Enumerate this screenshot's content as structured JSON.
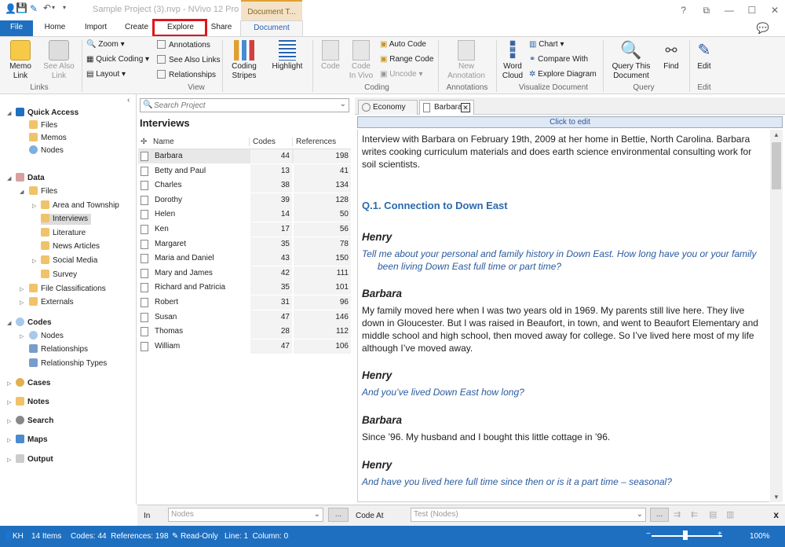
{
  "window": {
    "title": "Sample Project (3).nvp - NVivo 12 Pro",
    "context_tab": "Document T...",
    "help": "?",
    "restore": "⧉",
    "minimize": "—",
    "maximize": "☐",
    "close": "✕"
  },
  "tabs": [
    "File",
    "Home",
    "Import",
    "Create",
    "Explore",
    "Share",
    "Document"
  ],
  "ribbon": {
    "memo_link": "Memo\nLink",
    "see_also_link": "See Also\nLink",
    "links_group": "Links",
    "zoom": "Zoom",
    "quick_coding": "Quick Coding",
    "layout": "Layout",
    "annotations": "Annotations",
    "see_also_links": "See Also Links",
    "relationships": "Relationships",
    "view_group": "View",
    "coding_stripes": "Coding\nStripes",
    "highlight": "Highlight",
    "code": "Code",
    "code_in_vivo": "Code\nIn Vivo",
    "auto_code": "Auto Code",
    "range_code": "Range Code",
    "uncode": "Uncode",
    "coding_group": "Coding",
    "new_annotation": "New\nAnnotation",
    "annotations_group": "Annotations",
    "word_cloud": "Word\nCloud",
    "chart": "Chart",
    "compare_with": "Compare With",
    "explore_diagram": "Explore Diagram",
    "visualize_group": "Visualize Document",
    "query_this_document": "Query This\nDocument",
    "find": "Find",
    "query_group": "Query",
    "edit": "Edit",
    "edit_group": "Edit"
  },
  "nav": {
    "quick_access": "Quick Access",
    "files": "Files",
    "memos": "Memos",
    "nodes": "Nodes",
    "data": "Data",
    "data_files": "Files",
    "area_township": "Area and Township",
    "interviews": "Interviews",
    "literature": "Literature",
    "news_articles": "News Articles",
    "social_media": "Social Media",
    "survey": "Survey",
    "file_classifications": "File Classifications",
    "externals": "Externals",
    "codes": "Codes",
    "codes_nodes": "Nodes",
    "relationships": "Relationships",
    "relationship_types": "Relationship Types",
    "cases": "Cases",
    "notes": "Notes",
    "search": "Search",
    "maps": "Maps",
    "output": "Output"
  },
  "list": {
    "search_placeholder": "Search Project",
    "folder_title": "Interviews",
    "col_name": "Name",
    "col_codes": "Codes",
    "col_refs": "References",
    "rows": [
      {
        "name": "Barbara",
        "codes": "44",
        "refs": "198"
      },
      {
        "name": "Betty and Paul",
        "codes": "13",
        "refs": "41"
      },
      {
        "name": "Charles",
        "codes": "38",
        "refs": "134"
      },
      {
        "name": "Dorothy",
        "codes": "39",
        "refs": "128"
      },
      {
        "name": "Helen",
        "codes": "14",
        "refs": "50"
      },
      {
        "name": "Ken",
        "codes": "17",
        "refs": "56"
      },
      {
        "name": "Margaret",
        "codes": "35",
        "refs": "78"
      },
      {
        "name": "Maria and Daniel",
        "codes": "43",
        "refs": "150"
      },
      {
        "name": "Mary and James",
        "codes": "42",
        "refs": "111"
      },
      {
        "name": "Richard and Patricia",
        "codes": "35",
        "refs": "101"
      },
      {
        "name": "Robert",
        "codes": "31",
        "refs": "96"
      },
      {
        "name": "Susan",
        "codes": "47",
        "refs": "146"
      },
      {
        "name": "Thomas",
        "codes": "28",
        "refs": "112"
      },
      {
        "name": "William",
        "codes": "47",
        "refs": "106"
      }
    ]
  },
  "doc": {
    "tab1": "Economy",
    "tab2": "Barbara",
    "click_to_edit": "Click to edit",
    "intro": "Interview with Barbara on February 19th, 2009 at her home in Bettie, North Carolina. Barbara writes cooking curriculum materials and does earth science environmental consulting work for soil scientists.",
    "heading": "Q.1. Connection to Down East",
    "s1": "Henry",
    "q1": "Tell me about your personal and family history in Down East. How long have you or your family been living Down East full time or part time?",
    "s2": "Barbara",
    "a1": "My family moved here when I was two years old in 1969. My parents still live here. They live down in Gloucester. But I was raised in Beaufort, in town, and went to Beaufort Elementary and middle school and high school, then moved away for college. So I’ve lived here most of my life although I’ve moved away.",
    "s3": "Henry",
    "q2": "And you’ve lived Down East how long?",
    "s4": "Barbara",
    "a2": "Since ’96. My husband and I bought this little cottage in ’96.",
    "s5": "Henry",
    "q3": "And have you lived here full time since then or is it a part time – seasonal?"
  },
  "codebar": {
    "in": "In",
    "nodes_placeholder": "Nodes",
    "code_at": "Code At",
    "code_at_value": "Test (Nodes)",
    "browse": "...",
    "close": "x"
  },
  "status": {
    "user": "KH",
    "items": "14 Items",
    "codes_refs": "Codes: 44  References: 198",
    "readonly": "Read-Only",
    "position": "Line: 1  Column: 0",
    "zoom": "100%"
  },
  "colors": {
    "accent": "#1e6fc0",
    "highlight_box": "#e0141e",
    "question": "#2a5aa0"
  }
}
